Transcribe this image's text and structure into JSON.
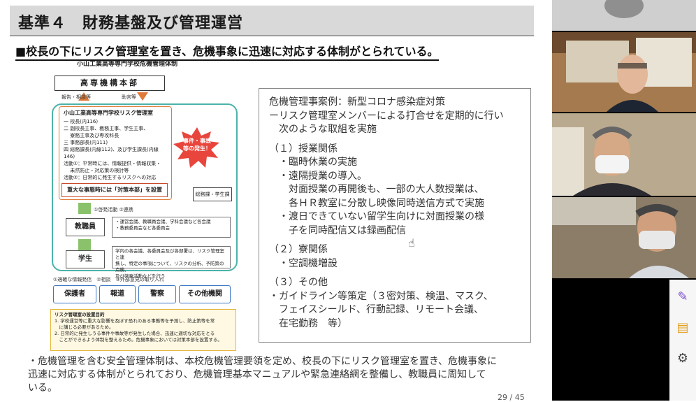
{
  "slide": {
    "title": "基準４　財務基盤及び管理運営",
    "subtitle": "■校長の下にリスク管理室を置き、危機事象に迅速に対応する体制がとられている。",
    "page_indicator": "29 / 45",
    "footer": [
      "・危機管理を含む安全管理体制は、本校危機管理要領を定め、校長の下にリスク管理室を置き、危機事象に",
      "迅速に対応する体制がとられており、危機管理基本マニュアルや緊急連絡網を整備し、教職員に周知して",
      "いる。"
    ]
  },
  "org_chart": {
    "title": "小山工業高等専門学校危機管理体制",
    "hq": "高専機構本部",
    "label_report": "報告・相談等",
    "label_advice": "助言等",
    "risk_room_title": "小山工業高等専門学校リスク管理室",
    "risk_room_lines": [
      "一 校長(内116)",
      "二 副校長主事、教務主事、学生主事、",
      "　 寮務主事及び専攻科長",
      "三 事務部長(内111)",
      "四 総務課長(内線112)、及び学生課長(内線146)",
      "活動①：平常時には、情報提供・情報収集・",
      "　 未然防止・対応策の検討等",
      "活動②：日常的に発生するリスクへの対応"
    ],
    "emergency_label": "重大な事態時には「対策本部」を設置",
    "incident_label": [
      "事件・事故",
      "等の発生！"
    ],
    "general_affairs": "総務課・学生課",
    "liaison_label": "①啓発活動 ②連携",
    "faculty": "教職員",
    "faculty_note": [
      "・運営会議、教職員会議、学科会議など各会議",
      "・教務委員会など各委員会"
    ],
    "students": "学生",
    "students_note": [
      "学内の各会議、各委員会及び各部署は、リスク管理室と連",
      "携し、特定の事項について、リスクの分析、予防策の点検、",
      "及び啓発活動などを行う"
    ],
    "external_row_label": "①適確な情報発信　②相談　③外部意見の取り入れ",
    "external": [
      "保護者",
      "報道",
      "警察",
      "その他機関"
    ],
    "criteria_title": "リスク管理室の設置目的",
    "criteria_lines": [
      "1. 学校運営等に重大な影響を及ぼす恐れのある事態等を予測し、防止策等を常",
      "　に講じる必要があるため。",
      "2. 日常的に発生しうる事件や事故等が発生した場合、迅速に適切な対応をとる",
      "　ことができるよう体制を整えるため。危機事象においては対策本部を設置する。"
    ]
  },
  "example": {
    "lines": [
      "危機管理事案例：新型コロナ感染症対策",
      "ーリスク管理室メンバーによる打合せを定期的に行い",
      "　次のような取組を実施",
      "",
      "（１）授業関係",
      "　・臨時休業の実施",
      "　・遠隔授業の導入。",
      "　　対面授業の再開後も、一部の大人数授業は、",
      "　　各ＨＲ教室に分散し映像同時送信方式で実施",
      "　・渡日できていない留学生向けに対面授業の様",
      "　　子を同時配信又は録画配信",
      "",
      "（２）寮関係",
      "　・空調機増設",
      "",
      "（３）その他",
      "・ガイドライン等策定（３密対策、検温、マスク、",
      "　フェイスシールド、行動記録、リモート会議、",
      "　在宅勤務　等）"
    ]
  },
  "video": {
    "participants": [
      "participant-1",
      "participant-2",
      "participant-3",
      "participant-4"
    ]
  },
  "tools": [
    "pen-icon",
    "note-icon",
    "settings-icon"
  ],
  "colors": {
    "risk_border": "#4bb3a9",
    "emergency": "#c94a2a",
    "incident": "#e8453c",
    "external_border": "#3b78c2",
    "hq_arrow": "#e07b39",
    "green": "#8ac26b"
  }
}
